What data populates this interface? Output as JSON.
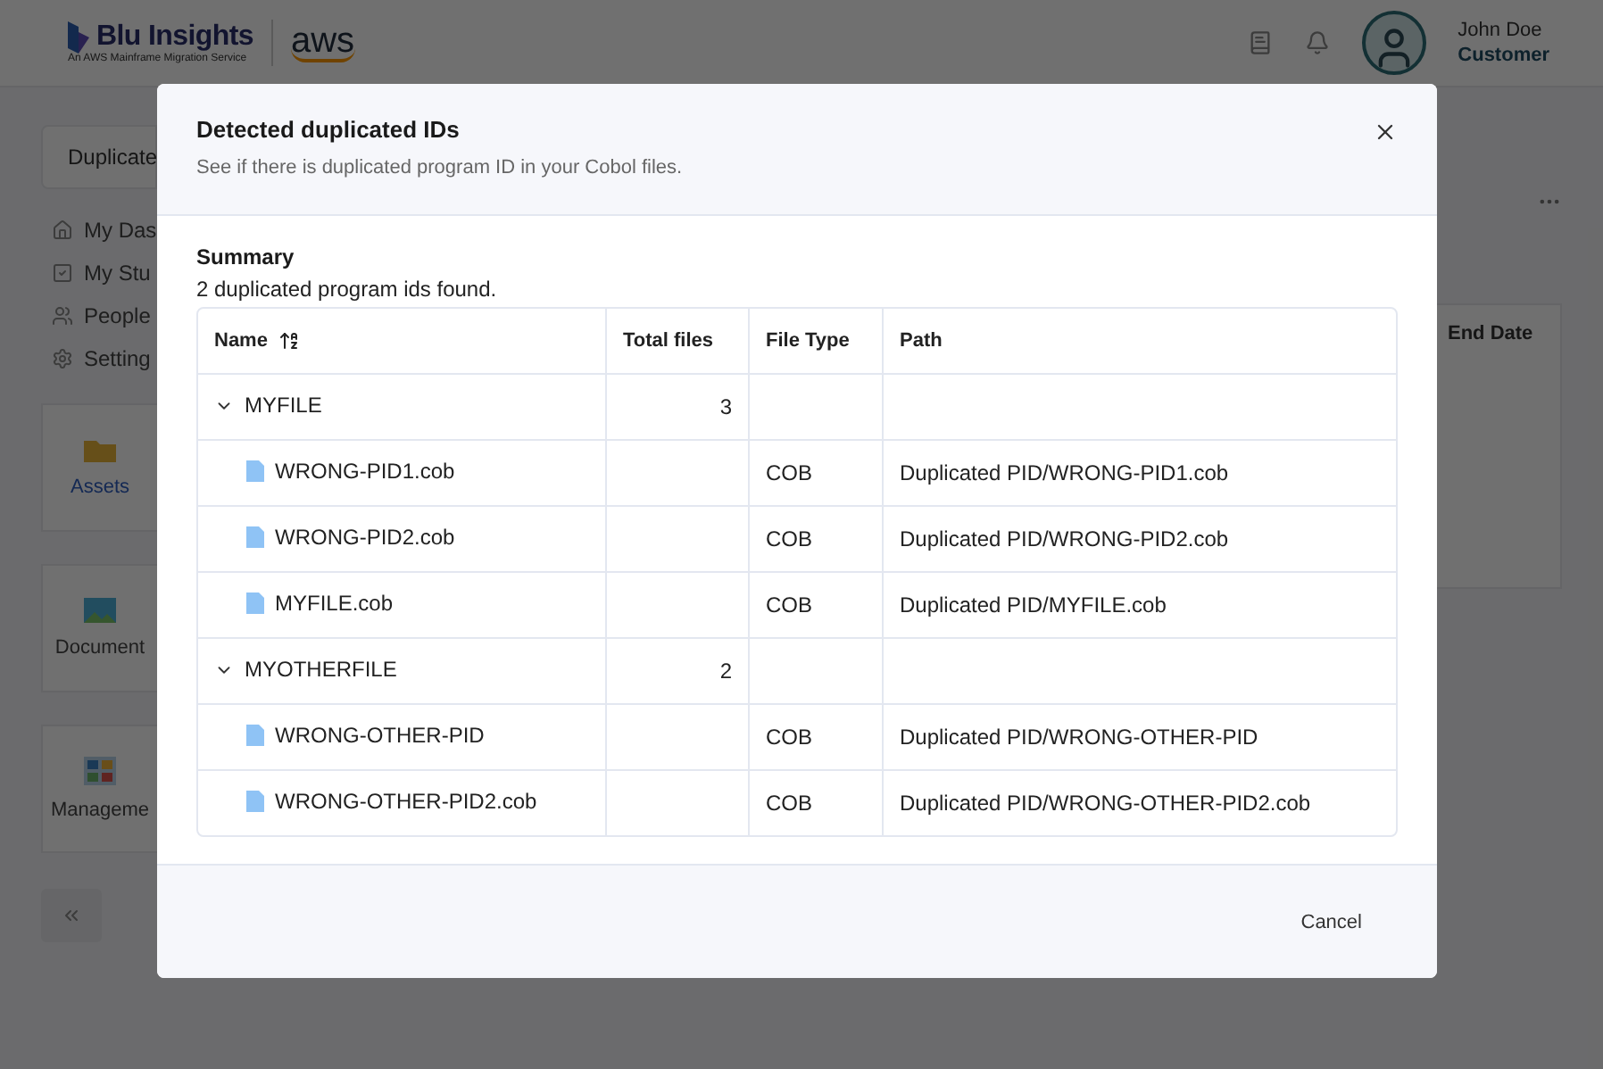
{
  "header": {
    "brand": "Blu Insights",
    "tagline": "An AWS Mainframe Migration Service",
    "partner": "aws",
    "user": {
      "name": "John Doe",
      "role": "Customer"
    }
  },
  "background": {
    "page_title": "Duplicate",
    "nav": [
      "My Das",
      "My Stu",
      "People",
      "Setting"
    ],
    "tiles": [
      {
        "label": "Assets",
        "selected": true,
        "kind": "folder"
      },
      {
        "label": "Document",
        "selected": false,
        "kind": "picture"
      },
      {
        "label": "Manageme",
        "selected": false,
        "kind": "board"
      }
    ],
    "column_header": "End Date"
  },
  "dialog": {
    "title": "Detected duplicated IDs",
    "subtitle": "See if there is duplicated program ID in your Cobol files.",
    "summary_title": "Summary",
    "summary": "2 duplicated program ids found.",
    "columns": [
      "Name",
      "Total files",
      "File Type",
      "Path"
    ],
    "groups": [
      {
        "name": "MYFILE",
        "total": "3",
        "expanded": true,
        "files": [
          {
            "name": "WRONG-PID1.cob",
            "type": "COB",
            "path": "Duplicated PID/WRONG-PID1.cob"
          },
          {
            "name": "WRONG-PID2.cob",
            "type": "COB",
            "path": "Duplicated PID/WRONG-PID2.cob"
          },
          {
            "name": "MYFILE.cob",
            "type": "COB",
            "path": "Duplicated PID/MYFILE.cob"
          }
        ]
      },
      {
        "name": "MYOTHERFILE",
        "total": "2",
        "expanded": true,
        "files": [
          {
            "name": "WRONG-OTHER-PID",
            "type": "COB",
            "path": "Duplicated PID/WRONG-OTHER-PID"
          },
          {
            "name": "WRONG-OTHER-PID2.cob",
            "type": "COB",
            "path": "Duplicated PID/WRONG-OTHER-PID2.cob"
          }
        ]
      }
    ],
    "cancel": "Cancel"
  }
}
